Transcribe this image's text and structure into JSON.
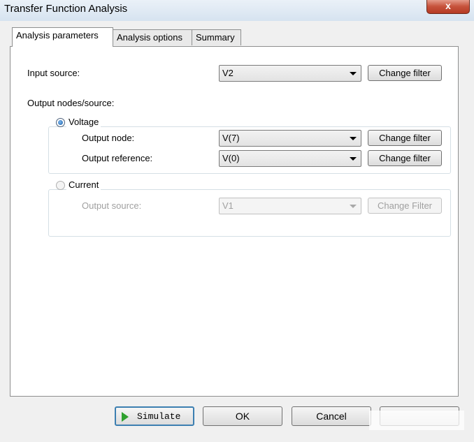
{
  "window": {
    "title": "Transfer Function Analysis",
    "close_label": "x"
  },
  "tabs": [
    {
      "label": "Analysis parameters",
      "active": true
    },
    {
      "label": "Analysis options",
      "active": false
    },
    {
      "label": "Summary",
      "active": false
    }
  ],
  "input_source": {
    "label": "Input source:",
    "value": "V2",
    "filter_label": "Change filter"
  },
  "output_section": {
    "label": "Output nodes/source:"
  },
  "voltage_group": {
    "label": "Voltage",
    "selected": true,
    "output_node": {
      "label": "Output node:",
      "value": "V(7)",
      "filter_label": "Change filter"
    },
    "output_reference": {
      "label": "Output reference:",
      "value": "V(0)",
      "filter_label": "Change filter"
    }
  },
  "current_group": {
    "label": "Current",
    "selected": false,
    "output_source": {
      "label": "Output source:",
      "value": "V1",
      "filter_label": "Change Filter"
    }
  },
  "footer": {
    "simulate_label": "Simulate",
    "ok_label": "OK",
    "cancel_label": "Cancel"
  },
  "colors": {
    "accent": "#3c7fb1",
    "play_icon": "#2fa12f",
    "close_button": "#c7533d"
  }
}
